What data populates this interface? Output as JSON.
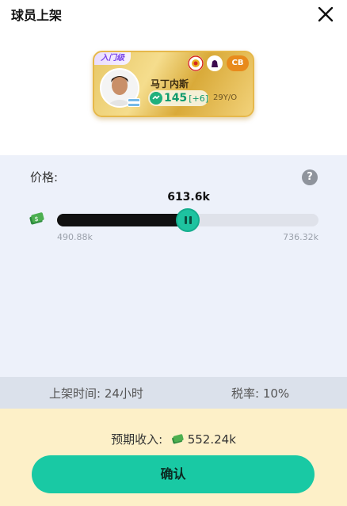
{
  "header": {
    "title": "球员上架"
  },
  "card": {
    "level_tag": "入门级",
    "name": "马丁内斯",
    "rating": "145",
    "rating_delta": "[+6]",
    "age": "29Y/O",
    "position": "CB"
  },
  "price": {
    "label": "价格:",
    "help": "?",
    "current": "613.6k",
    "min": "490.88k",
    "max": "736.32k",
    "slider_fraction": 0.5
  },
  "info": {
    "list_time": "上架时间: 24小时",
    "tax": "税率: 10%"
  },
  "expected": {
    "label": "预期收入:",
    "value": "552.24k"
  },
  "confirm_label": "确认",
  "colors": {
    "accent": "#19c9a4",
    "panel_bg": "#edf1fa",
    "bottom_bg": "#fdf0c8",
    "card_gold": "#e6b84a",
    "position_badge": "#e88a1c"
  }
}
